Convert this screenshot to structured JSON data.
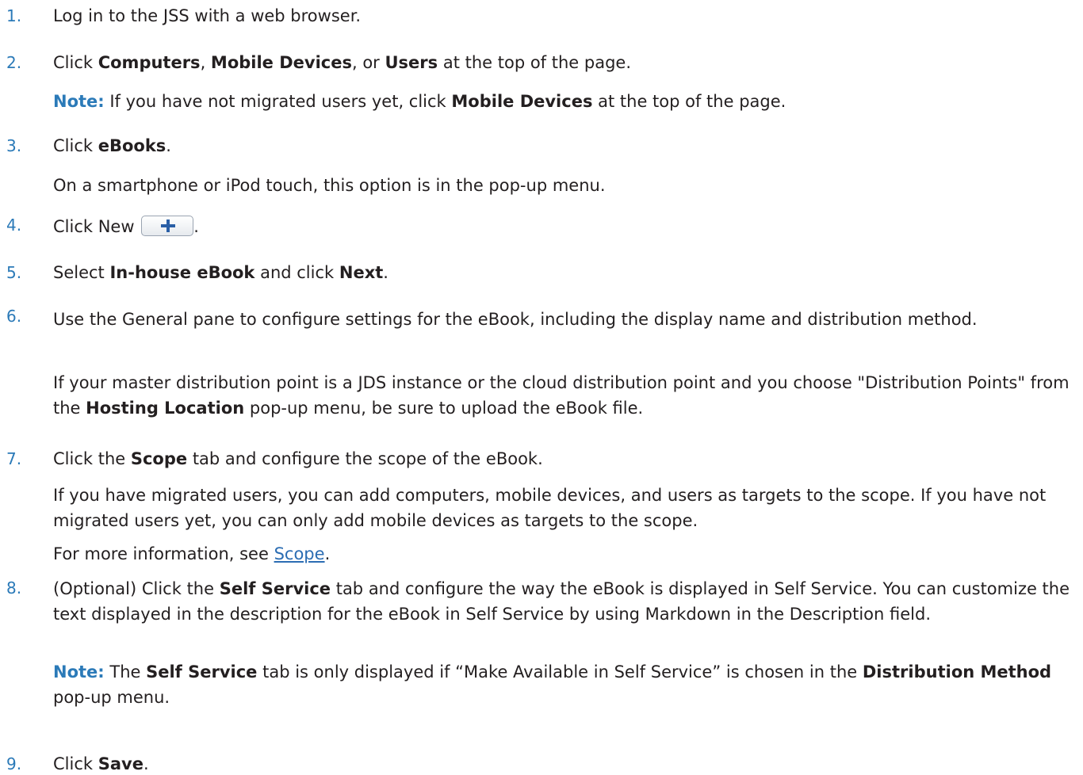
{
  "steps": [
    {
      "num": "1.",
      "text": "Log in to the JSS with a web browser."
    },
    {
      "num": "2.",
      "pre": "Click ",
      "b1": "Computers",
      "mid1": ", ",
      "b2": "Mobile Devices",
      "mid2": ", or ",
      "b3": "Users",
      "post": " at the top of the page.",
      "note_label": "Note:",
      "note_pre": " If you have not migrated users yet, click ",
      "note_b": "Mobile Devices",
      "note_post": " at the top of the page."
    },
    {
      "num": "3.",
      "pre": "Click ",
      "b1": "eBooks",
      "post": ".",
      "sub": "On a smartphone or iPod touch, this option is in the pop-up menu."
    },
    {
      "num": "4.",
      "pre": "Click New ",
      "post": ".",
      "button_icon": "plus-icon"
    },
    {
      "num": "5.",
      "pre": "Select ",
      "b1": "In-house eBook",
      "mid1": " and click ",
      "b2": "Next",
      "post": "."
    },
    {
      "num": "6.",
      "text": "Use the General pane to configure settings for the eBook, including the display name and distribution method.",
      "sub_pre": "If your master distribution point is a JDS instance or the cloud distribution point and you choose \"Distribution Points\" from the ",
      "sub_b": "Hosting Location",
      "sub_post": " pop-up menu, be sure to upload the eBook file."
    },
    {
      "num": "7.",
      "pre": "Click the ",
      "b1": "Scope",
      "post": " tab and configure the scope of the eBook.",
      "sub": "If you have migrated users, you can add computers, mobile devices, and users as targets to the scope. If you have not migrated users yet, you can only add mobile devices as targets to the scope.",
      "more_pre": "For more information, see ",
      "more_link": "Scope",
      "more_post": "."
    },
    {
      "num": "8.",
      "pre": "(Optional) Click the ",
      "b1": "Self Service",
      "post": " tab and configure the way the eBook is displayed in Self Service. You can customize the text displayed in the description for the eBook in Self Service by using Markdown in the Description field.",
      "note_label": "Note:",
      "note_pre": " The ",
      "note_b": "Self Service",
      "note_mid": " tab is only displayed if “Make Available in Self Service” is chosen in the ",
      "note_b2": "Distribution Method",
      "note_post": " pop-up menu."
    },
    {
      "num": "9.",
      "pre": "Click ",
      "b1": "Save",
      "post": "."
    }
  ]
}
